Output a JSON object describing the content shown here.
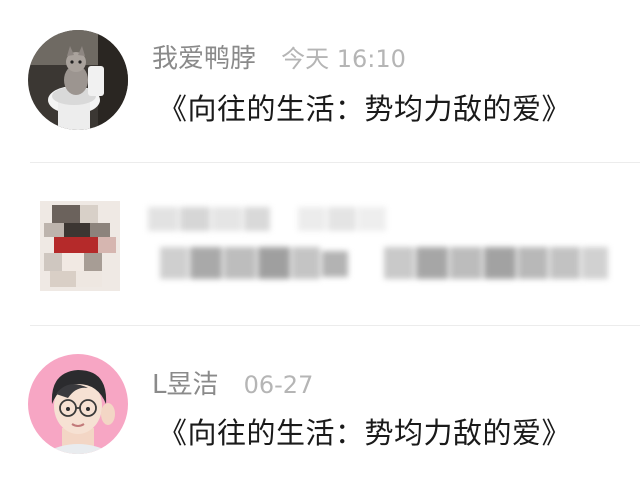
{
  "comments": [
    {
      "username": "我爱鸭脖",
      "time": "今天 16:10",
      "content": "《向往的生活：势均力敌的爱》",
      "avatar_icon": "cat-on-toilet-avatar"
    },
    {
      "username": "",
      "time": "",
      "content": "",
      "avatar_icon": "pixelated-avatar",
      "blurred": true
    },
    {
      "username": "L昱洁",
      "time": "06-27",
      "content": "《向往的生活：势均力敌的爱》",
      "avatar_icon": "cartoon-boy-avatar"
    }
  ],
  "colors": {
    "username": "#8a8a8a",
    "time": "#b5b5b5",
    "content": "#1a1a1a",
    "avatar2_bg": "#f7a6c4"
  }
}
